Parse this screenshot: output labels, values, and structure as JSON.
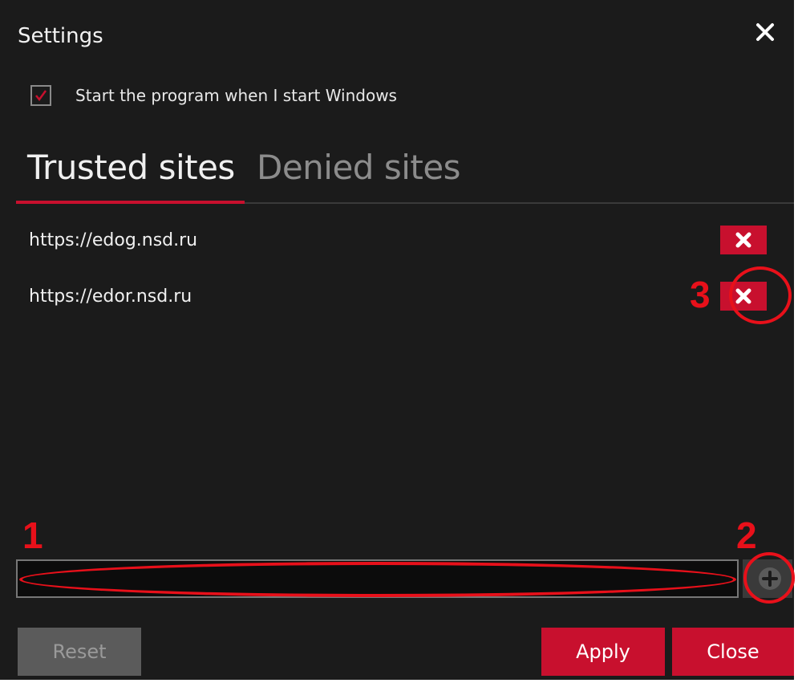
{
  "window": {
    "title": "Settings",
    "close_icon": "close-icon"
  },
  "startup": {
    "label": "Start the program when I start Windows",
    "checked": true
  },
  "tabs": [
    {
      "label": "Trusted sites",
      "active": true
    },
    {
      "label": "Denied sites",
      "active": false
    }
  ],
  "sites": [
    {
      "url": "https://edog.nsd.ru"
    },
    {
      "url": "https://edor.nsd.ru"
    }
  ],
  "new_site": {
    "value": "",
    "placeholder": ""
  },
  "annotations": {
    "input_marker": "1",
    "add_marker": "2",
    "remove_marker": "3"
  },
  "buttons": {
    "reset": "Reset",
    "apply": "Apply",
    "close": "Close"
  },
  "colors": {
    "background": "#1b1b1b",
    "accent": "#c8102e",
    "annotation": "#e8101a",
    "disabled_button": "#5b5b5b"
  }
}
